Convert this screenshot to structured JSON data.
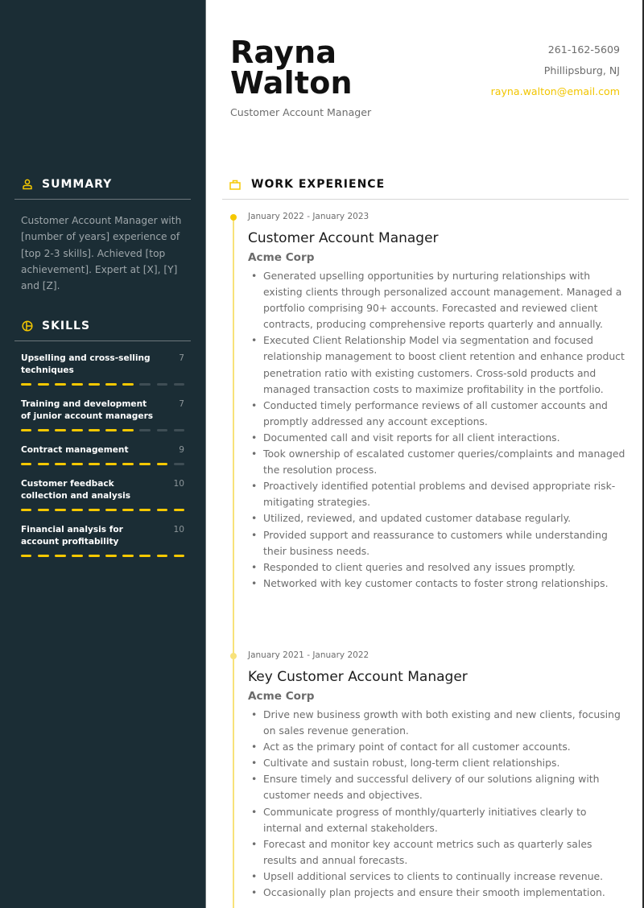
{
  "colors": {
    "sidebar_bg": "#1b2d35",
    "accent": "#f5c800",
    "accent_light": "#f8e27a",
    "text_muted": "#6d6d6d"
  },
  "header": {
    "first_name": "Rayna",
    "last_name": "Walton",
    "role": "Customer Account Manager",
    "phone": "261-162-5609",
    "location": "Phillipsburg, NJ",
    "email": "rayna.walton@email.com"
  },
  "sidebar": {
    "summary": {
      "title": "SUMMARY",
      "icon": "user-icon",
      "text": "Customer Account Manager with [number of years] experience of [top 2-3 skills]. Achieved [top achievement]. Expert at [X], [Y] and [Z]."
    },
    "skills": {
      "title": "SKILLS",
      "icon": "pie-chart-icon",
      "max": 10,
      "items": [
        {
          "name": "Upselling and cross-selling techniques",
          "score": 7
        },
        {
          "name": "Training and development of junior account managers",
          "score": 7
        },
        {
          "name": "Contract management",
          "score": 9
        },
        {
          "name": "Customer feedback collection and analysis",
          "score": 10
        },
        {
          "name": "Financial analysis for account profitability",
          "score": 10
        }
      ]
    }
  },
  "work": {
    "title": "WORK EXPERIENCE",
    "icon": "briefcase-icon",
    "jobs": [
      {
        "dates": "January 2022 - January 2023",
        "title": "Customer Account Manager",
        "company": "Acme Corp",
        "bullets": [
          "Generated upselling opportunities by nurturing relationships with existing clients through personalized account management. Managed a portfolio comprising 90+ accounts. Forecasted and reviewed client contracts, producing comprehensive reports quarterly and annually.",
          "Executed Client Relationship Model via segmentation and focused relationship management to boost client retention and enhance product penetration ratio with existing customers. Cross-sold products and managed transaction costs to maximize profitability in the portfolio.",
          "Conducted timely performance reviews of all customer accounts and promptly addressed any account exceptions.",
          "Documented call and visit reports for all client interactions.",
          "Took ownership of escalated customer queries/complaints and managed the resolution process.",
          "Proactively identified potential problems and devised appropriate risk-mitigating strategies.",
          "Utilized, reviewed, and updated customer database regularly.",
          "Provided support and reassurance to customers while understanding their business needs.",
          "Responded to client queries and resolved any issues promptly.",
          "Networked with key customer contacts to foster strong relationships."
        ]
      },
      {
        "dates": "January 2021 - January 2022",
        "title": "Key Customer Account Manager",
        "company": "Acme Corp",
        "bullets": [
          "Drive new business growth with both existing and new clients, focusing on sales revenue generation.",
          "Act as the primary point of contact for all customer accounts.",
          "Cultivate and sustain robust, long-term client relationships.",
          "Ensure timely and successful delivery of our solutions aligning with customer needs and objectives.",
          "Communicate progress of monthly/quarterly initiatives clearly to internal and external stakeholders.",
          "Forecast and monitor key account metrics such as quarterly sales results and annual forecasts.",
          "Upsell additional services to clients to continually increase revenue.",
          "Occasionally plan projects and ensure their smooth implementation."
        ]
      }
    ]
  }
}
